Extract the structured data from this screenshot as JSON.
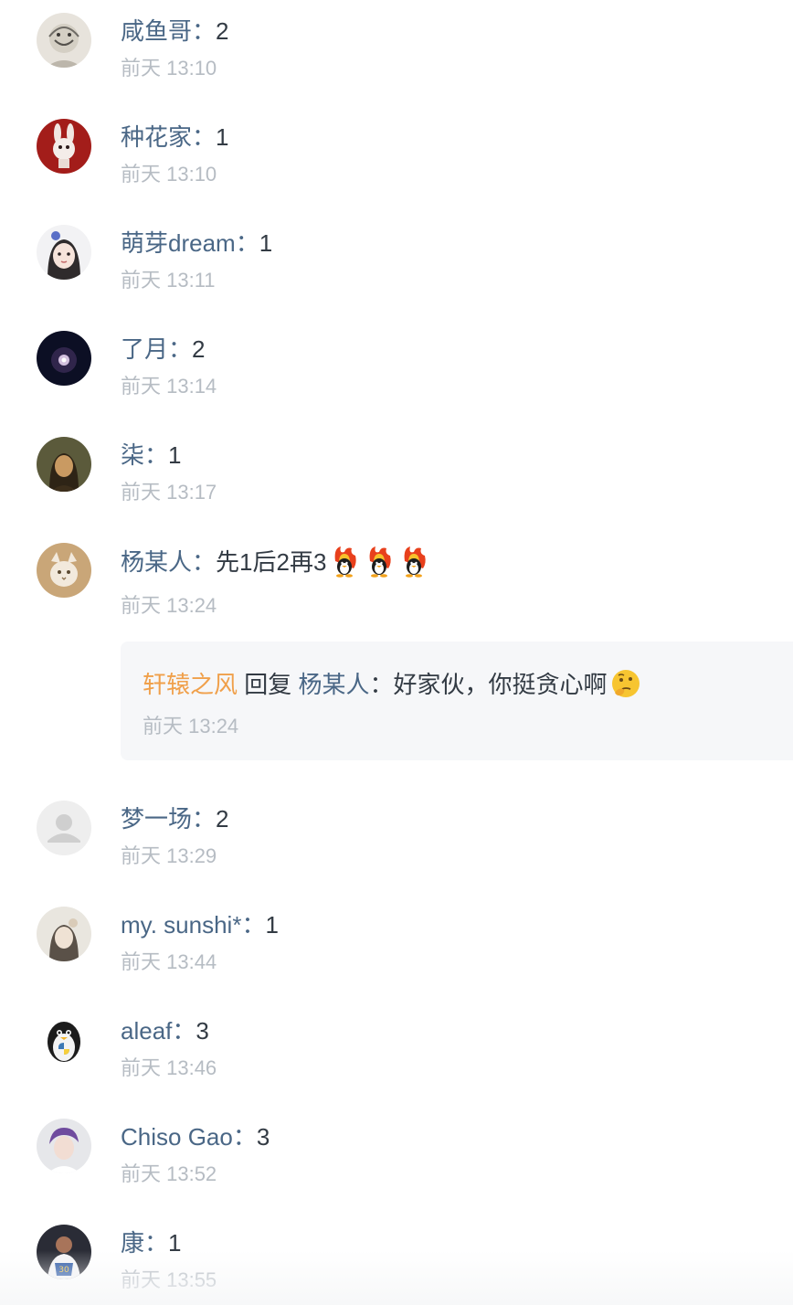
{
  "comments": [
    {
      "name": "咸鱼哥",
      "colon": "：",
      "text": "2",
      "time": "前天 13:10"
    },
    {
      "name": "种花家",
      "colon": "：",
      "text": "1",
      "time": "前天 13:10"
    },
    {
      "name": "萌芽dream",
      "colon": "：",
      "text": "1",
      "time": "前天 13:11"
    },
    {
      "name": "了月",
      "colon": "：",
      "text": "2",
      "time": "前天 13:14"
    },
    {
      "name": "柒",
      "colon": "：",
      "text": "1",
      "time": "前天 13:17"
    },
    {
      "name": "杨某人",
      "colon": "：",
      "text": "先1后2再3",
      "time": "前天 13:24"
    },
    {
      "name": "梦一场",
      "colon": "：",
      "text": "2",
      "time": "前天 13:29"
    },
    {
      "name": "my. sunshi*",
      "colon": "：",
      "text": "1",
      "time": "前天 13:44"
    },
    {
      "name": "aleaf",
      "colon": "：",
      "text": "3",
      "time": "前天 13:46"
    },
    {
      "name": "Chiso Gao",
      "colon": "：",
      "text": "3",
      "time": "前天 13:52"
    },
    {
      "name": "康",
      "colon": "：",
      "text": "1",
      "time": "前天 13:55"
    }
  ],
  "reply": {
    "author": "轩辕之风",
    "verb": " 回复 ",
    "target": "杨某人",
    "colon": "：",
    "text": "好家伙，你挺贪心啊",
    "time": "前天 13:24"
  },
  "emojis": {
    "fire_penguin": "fire-penguin-emoji",
    "thinking": "thinking-face-emoji"
  },
  "colors": {
    "name": "#4a6786",
    "time": "#b6bcc3",
    "reply_author": "#f0a04b",
    "reply_bg": "#f6f7f9"
  }
}
